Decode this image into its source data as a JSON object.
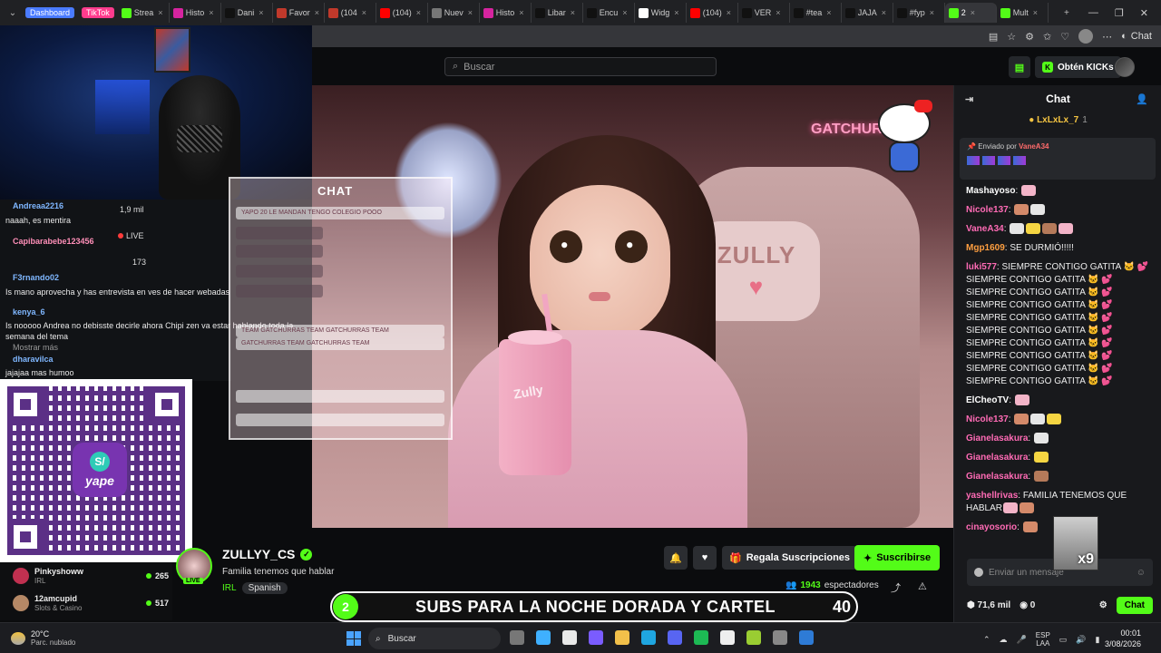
{
  "browser": {
    "tabs": [
      {
        "label": "Dashboard",
        "color": "#4a7bff",
        "pill": true
      },
      {
        "label": "TikTok",
        "color": "#ff3b8d",
        "pill": true
      },
      {
        "label": "Strea",
        "color": "#53fc18"
      },
      {
        "label": "Histo",
        "color": "#d6249f"
      },
      {
        "label": "Dani",
        "color": "#111111"
      },
      {
        "label": "Favor",
        "color": "#c0392b"
      },
      {
        "label": "(104",
        "color": "#c0392b"
      },
      {
        "label": "(104)",
        "color": "#ff0000"
      },
      {
        "label": "Nuev",
        "color": "#777777"
      },
      {
        "label": "Histo",
        "color": "#d6249f"
      },
      {
        "label": "Libar",
        "color": "#111111"
      },
      {
        "label": "Encu",
        "color": "#111111"
      },
      {
        "label": "Widg",
        "color": "#ffffff"
      },
      {
        "label": "(104)",
        "color": "#ff0000"
      },
      {
        "label": "VER",
        "color": "#111111"
      },
      {
        "label": "#tea",
        "color": "#111111"
      },
      {
        "label": "JAJA",
        "color": "#111111"
      },
      {
        "label": "#fyp",
        "color": "#111111"
      },
      {
        "label": "2",
        "color": "#53fc18",
        "active": true
      },
      {
        "label": "Mult",
        "color": "#53fc18"
      }
    ],
    "toolbar_chat_label": "Chat"
  },
  "kick_header": {
    "search_placeholder": "Buscar",
    "get_kicks_label": "Obtén KICKs"
  },
  "left_overlay": {
    "lines": [
      {
        "user": "Andreaa2216",
        "text": ""
      },
      {
        "user": "",
        "text": "naaah, es mentira"
      },
      {
        "user": "Capibarabebe123456",
        "text": ""
      },
      {
        "user": "F3rnando02",
        "text": ""
      },
      {
        "user": "",
        "text": "Is mano aprovecha y has entrevista en ves de hacer webadas"
      },
      {
        "user": "kenya_6",
        "text": ""
      },
      {
        "user": "",
        "text": "Is nooooo Andrea no debisste decirle ahora Chipi zen va estar hablando toda la"
      },
      {
        "user": "",
        "text": "semana del tema"
      },
      {
        "user": "",
        "text": "Mostrar más"
      },
      {
        "user": "dharavilca",
        "text": ""
      },
      {
        "user": "",
        "text": "jajajaa mas humoo"
      }
    ],
    "stats": {
      "followers": "1,9 mil",
      "live": "LIVE",
      "viewers": "173"
    }
  },
  "side_channels": [
    {
      "name": "Pinkyshoww",
      "category": "IRL",
      "viewers": "265"
    },
    {
      "name": "12amcupid",
      "category": "Slots & Casino",
      "viewers": "517"
    }
  ],
  "video": {
    "seat_brand": "ZULLY",
    "neon_sign": "GATCHURRAS",
    "cup_label": "Zully",
    "chat_overlay_title": "CHAT",
    "chat_rows": [
      "YAPO 20 LE MANDAN TENGO COLEGIO POOO",
      "",
      "",
      "",
      "",
      "TEAM GATCHURRAS TEAM GATCHURRAS TEAM",
      "GATCHURRAS TEAM GATCHURRAS TEAM",
      "",
      ""
    ]
  },
  "stream": {
    "channel_name": "ZULLYY_CS",
    "title": "Familia tenemos que hablar",
    "category": "IRL",
    "language": "Spanish",
    "live_badge": "LIVE",
    "gift_label": "Regala Suscripciones",
    "subscribe_label": "Suscribirse",
    "viewers": "1943",
    "viewers_label": "espectadores"
  },
  "sub_goal": {
    "current": "2",
    "text": "SUBS PARA LA NOCHE DORADA Y CARTEL",
    "target": "40"
  },
  "chat": {
    "header": "Chat",
    "leader": {
      "name": "LxLxLx_7",
      "count": "1"
    },
    "pinned": {
      "label": "Enviado por",
      "by": "VaneA34"
    },
    "messages": [
      {
        "user": "Mashayoso",
        "color": "#ffffff",
        "text": "",
        "emotes": 1
      },
      {
        "user": "Nicole137",
        "color": "#ff6bb5",
        "text": "",
        "emotes": 2
      },
      {
        "user": "VaneA34",
        "color": "#ff6bb5",
        "text": "",
        "emotes": 4
      },
      {
        "user": "Mgp1609",
        "color": "#ff9f40",
        "text": "SE DURMIÓ!!!!!",
        "emotes": 0
      },
      {
        "user": "luki577",
        "color": "#ff6bb5",
        "text": "SIEMPRE CONTIGO GATITA 🐱 💕 SIEMPRE CONTIGO GATITA 🐱 💕 SIEMPRE CONTIGO GATITA 🐱 💕 SIEMPRE CONTIGO GATITA 🐱 💕 SIEMPRE CONTIGO GATITA 🐱 💕 SIEMPRE CONTIGO GATITA 🐱 💕 SIEMPRE CONTIGO GATITA 🐱 💕 SIEMPRE CONTIGO GATITA 🐱 💕 SIEMPRE CONTIGO GATITA 🐱 💕 SIEMPRE CONTIGO GATITA 🐱 💕",
        "emotes": 0
      },
      {
        "user": "ElCheoTV",
        "color": "#ffffff",
        "text": "",
        "emotes": 1
      },
      {
        "user": "Nicole137",
        "color": "#ff6bb5",
        "text": "",
        "emotes": 3
      },
      {
        "user": "Gianelasakura",
        "color": "#ff6bb5",
        "text": "",
        "emotes": 1
      },
      {
        "user": "Gianelasakura",
        "color": "#ff6bb5",
        "text": "",
        "emotes": 1
      },
      {
        "user": "Gianelasakura",
        "color": "#ff6bb5",
        "text": "",
        "emotes": 1
      },
      {
        "user": "yashellrivas",
        "color": "#ff6bb5",
        "text": "FAMILIA TENEMOS QUE HABLAR",
        "emotes": 2
      },
      {
        "user": "cinayosorio",
        "color": "#ff6bb5",
        "text": "",
        "emotes": 1
      }
    ],
    "gif_label": "x9",
    "input_placeholder": "Enviar un mensaje",
    "kicks_balance": "71,6 mil",
    "points": "0",
    "send_label": "Chat"
  },
  "taskbar": {
    "weather_temp": "20°C",
    "weather_desc": "Parc. nublado",
    "search_placeholder": "Buscar",
    "lang": "ESP",
    "lang2": "LAA",
    "time": "00:01",
    "date": "3/08/2026"
  },
  "colors": {
    "kick_green": "#53fc18",
    "background": "#0b0c0e",
    "chat_bg": "#18191c"
  }
}
